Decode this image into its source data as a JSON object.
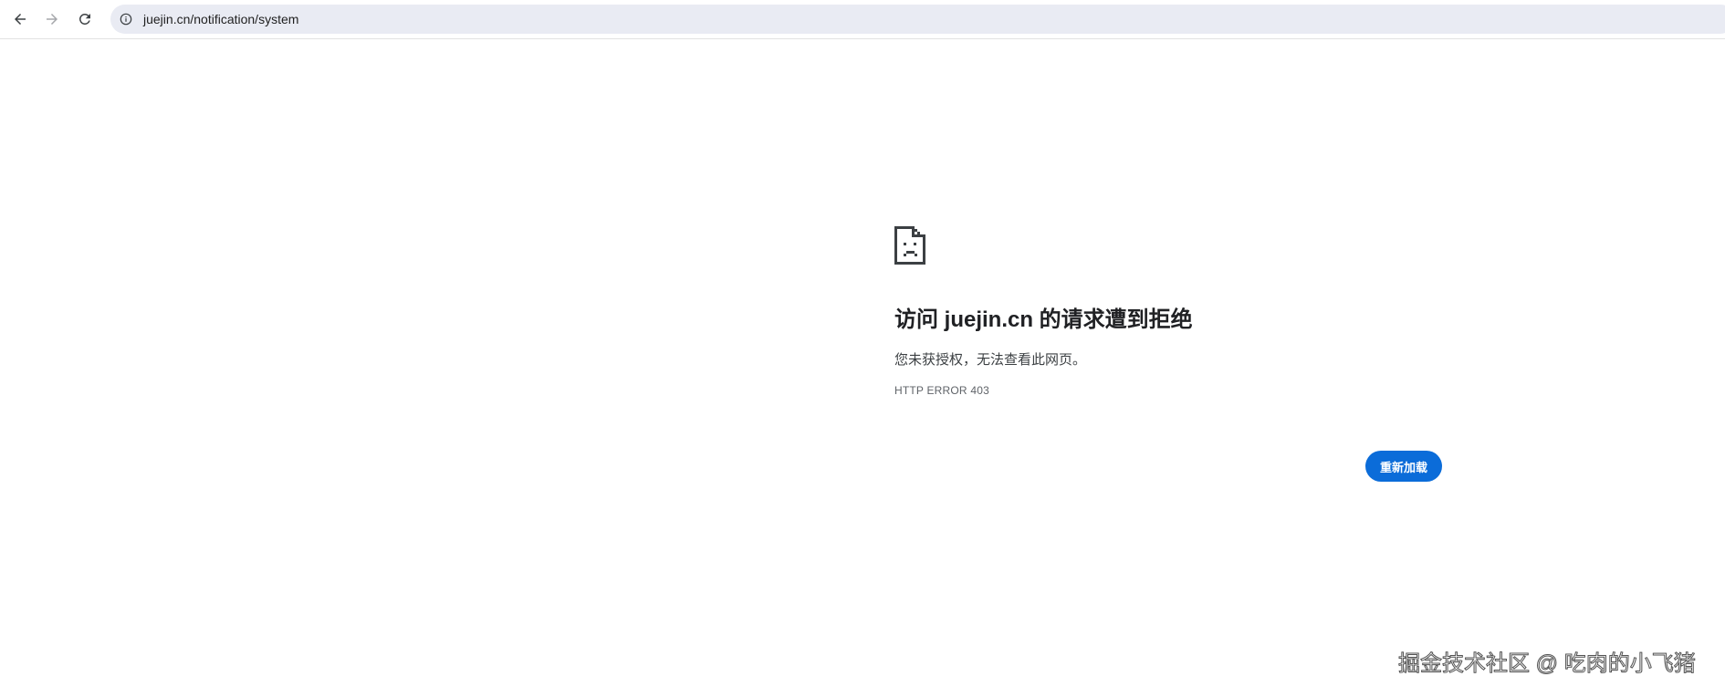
{
  "browser": {
    "url": "juejin.cn/notification/system",
    "back_icon": "arrow-left-icon",
    "forward_icon": "arrow-right-icon",
    "reload_icon": "reload-icon",
    "site_info_icon": "info-circle-icon"
  },
  "error_page": {
    "icon": "sad-document-icon",
    "heading": "访问 juejin.cn 的请求遭到拒绝",
    "description": "您未获授权，无法查看此网页。",
    "error_code": "HTTP ERROR 403",
    "reload_label": "重新加载"
  },
  "watermark": {
    "text": "掘金技术社区 @ 吃肉的小飞猪"
  },
  "colors": {
    "accent": "#0b6cd9",
    "omnibox_bg": "#e9ebf3",
    "heading": "#202124"
  }
}
